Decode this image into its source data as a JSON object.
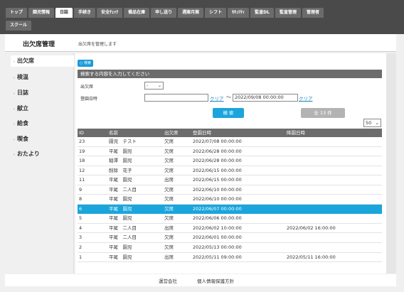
{
  "nav": {
    "row1": [
      {
        "label": "トップ",
        "active": false
      },
      {
        "label": "園児情報",
        "active": false
      },
      {
        "label": "日誌",
        "active": true
      },
      {
        "label": "手続き",
        "active": false
      },
      {
        "label": "安全ﾁｪｯｸ",
        "active": false
      },
      {
        "label": "備品在庫",
        "active": false
      },
      {
        "label": "申し送り",
        "active": false
      },
      {
        "label": "週案月案",
        "active": false
      },
      {
        "label": "シフト",
        "active": false
      },
      {
        "label": "ｾｷｭﾘﾃｨ",
        "active": false
      },
      {
        "label": "監査DL",
        "active": false
      },
      {
        "label": "監査管理",
        "active": false
      },
      {
        "label": "管理者",
        "active": false
      }
    ],
    "row2": [
      {
        "label": "スクール",
        "active": false
      }
    ]
  },
  "header": {
    "title": "出欠席管理",
    "description": "出欠席を管理します"
  },
  "sidebar": {
    "items": [
      {
        "label": "出欠席",
        "active": true
      },
      {
        "label": "検温",
        "active": false
      },
      {
        "label": "日誌",
        "active": false
      },
      {
        "label": "献立",
        "active": false
      },
      {
        "label": "給食",
        "active": false
      },
      {
        "label": "喫食",
        "active": false
      },
      {
        "label": "おたより",
        "active": false
      }
    ]
  },
  "search": {
    "tag_label": "検索",
    "heading": "検索する内容を入力してください",
    "status_label": "出欠席",
    "status_value": "-",
    "date_label": "登園日時",
    "date_from": "",
    "date_to": "2022/09/08 00:00:00",
    "clear_label": "クリア",
    "tilde": "～",
    "search_button": "検 索",
    "count_label": "全 13 件",
    "per_page": "50"
  },
  "table": {
    "headers": {
      "id": "ID",
      "name": "名前",
      "status": "出欠席",
      "registered": "登園日時",
      "updated": "降園日時"
    },
    "rows": [
      {
        "id": "23",
        "name": "園児　テスト",
        "status": "欠席",
        "registered": "2022/07/08 00:00:00",
        "updated": "",
        "selected": false
      },
      {
        "id": "19",
        "name": "平尾　園児",
        "status": "欠席",
        "registered": "2022/06/28 00:00:00",
        "updated": "",
        "selected": false
      },
      {
        "id": "18",
        "name": "稲澤　園児",
        "status": "欠席",
        "registered": "2022/06/28 00:00:00",
        "updated": "",
        "selected": false
      },
      {
        "id": "12",
        "name": "削除　花子",
        "status": "欠席",
        "registered": "2022/06/15 00:00:00",
        "updated": "",
        "selected": false
      },
      {
        "id": "11",
        "name": "平尾　園児",
        "status": "出席",
        "registered": "2022/06/15 00:00:00",
        "updated": "",
        "selected": false
      },
      {
        "id": "9",
        "name": "平尾　二人目",
        "status": "欠席",
        "registered": "2022/06/10 00:00:00",
        "updated": "",
        "selected": false
      },
      {
        "id": "8",
        "name": "平尾　園児",
        "status": "欠席",
        "registered": "2022/06/10 00:00:00",
        "updated": "",
        "selected": false
      },
      {
        "id": "6",
        "name": "平尾　園児",
        "status": "欠席",
        "registered": "2022/06/07 00:00:00",
        "updated": "",
        "selected": true
      },
      {
        "id": "5",
        "name": "平尾　園児",
        "status": "欠席",
        "registered": "2022/06/06 00:00:00",
        "updated": "",
        "selected": false
      },
      {
        "id": "4",
        "name": "平尾　二人目",
        "status": "出席",
        "registered": "2022/06/02 10:00:00",
        "updated": "2022/06/02 16:00:00",
        "selected": false
      },
      {
        "id": "3",
        "name": "平尾　二人目",
        "status": "欠席",
        "registered": "2022/06/01 00:00:00",
        "updated": "",
        "selected": false
      },
      {
        "id": "2",
        "name": "平尾　園児",
        "status": "欠席",
        "registered": "2022/05/13 00:00:00",
        "updated": "",
        "selected": false
      },
      {
        "id": "1",
        "name": "平尾　園児",
        "status": "出席",
        "registered": "2022/05/11 09:00:00",
        "updated": "2022/05/11 16:00:00",
        "selected": false
      }
    ]
  },
  "footer": {
    "company": "運営会社",
    "privacy": "個人情報保護方針"
  }
}
